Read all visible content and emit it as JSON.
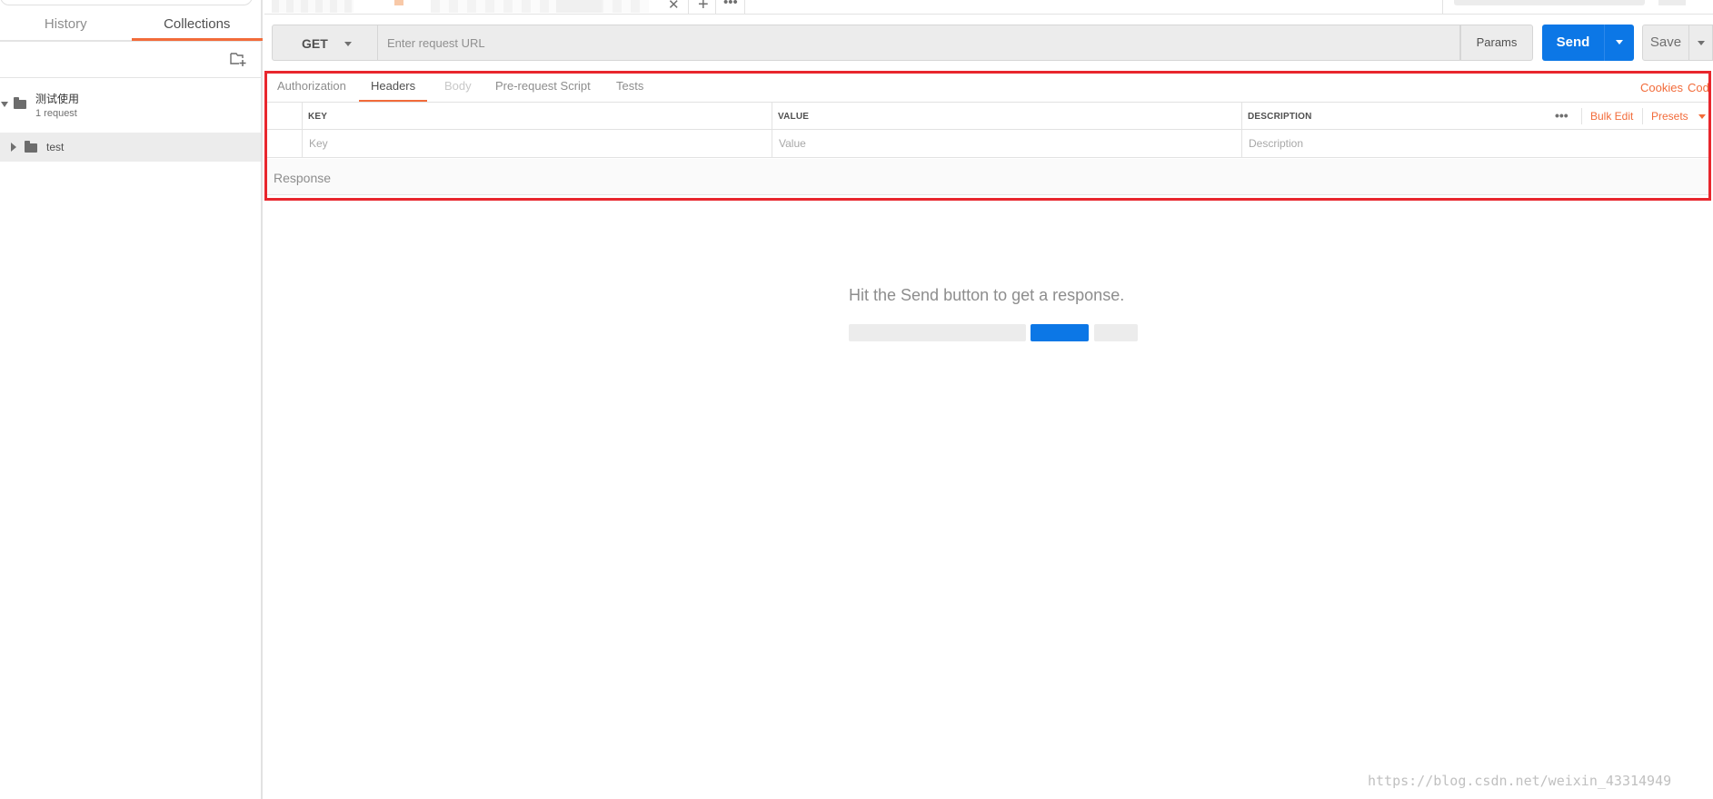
{
  "sidebar": {
    "tabs": [
      {
        "label": "History",
        "active": false
      },
      {
        "label": "Collections",
        "active": true
      }
    ],
    "new_collection_icon": "folder-plus-icon",
    "collection": {
      "name": "测试使用",
      "count": "1 request"
    },
    "folder": {
      "name": "test"
    }
  },
  "tabbar": {
    "close_glyph": "✕",
    "plus_glyph": "+",
    "more_glyph": "•••"
  },
  "request": {
    "method": "GET",
    "url_placeholder": "Enter request URL",
    "url_value": "",
    "params_label": "Params",
    "send_label": "Send",
    "save_label": "Save"
  },
  "request_tabs": [
    {
      "label": "Authorization",
      "state": "normal"
    },
    {
      "label": "Headers",
      "state": "active"
    },
    {
      "label": "Body",
      "state": "disabled"
    },
    {
      "label": "Pre-request Script",
      "state": "normal"
    },
    {
      "label": "Tests",
      "state": "normal"
    }
  ],
  "links": {
    "cookies": "Cookies",
    "code": "Code"
  },
  "headers_table": {
    "columns": [
      "KEY",
      "VALUE",
      "DESCRIPTION"
    ],
    "placeholders": {
      "key": "Key",
      "value": "Value",
      "description": "Description"
    },
    "more_glyph": "•••",
    "bulk_edit": "Bulk Edit",
    "presets": "Presets"
  },
  "response": {
    "label": "Response",
    "empty_message": "Hit the Send button to get a response."
  },
  "watermark": "https://blog.csdn.net/weixin_43314949",
  "colors": {
    "accent_orange": "#f26b3a",
    "send_blue": "#0c77e6",
    "highlight_red": "#e8262d"
  }
}
